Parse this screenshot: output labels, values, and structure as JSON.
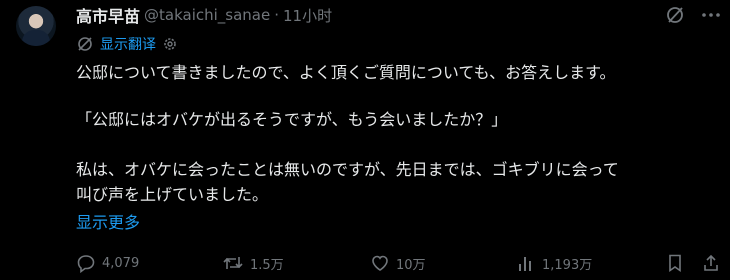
{
  "author": {
    "name": "高市早苗",
    "handle": "@takaichi_sanae",
    "separator": "·",
    "time": "11小时"
  },
  "translate": {
    "label": "显示翻译"
  },
  "post": {
    "lines": [
      "公邸について書きましたので、よく頂くご質問についても、お答えします。",
      "「公邸にはオバケが出るそうですが、もう会いましたか？」",
      "私は、オバケに会ったことは無いのですが、先日までは、ゴキブリに会って",
      "叫び声を上げていました。"
    ],
    "show_more": "显示更多"
  },
  "actions": {
    "replies": "4,079",
    "reposts": "1.5万",
    "likes": "10万",
    "views": "1,193万"
  },
  "colors": {
    "accent": "#1d9bf0",
    "muted": "#71767b",
    "text": "#e7e9ea",
    "background": "#000000"
  },
  "icons": [
    "grok-icon",
    "more-icon",
    "translate-icon",
    "gear-icon",
    "reply-icon",
    "repost-icon",
    "like-icon",
    "views-icon",
    "bookmark-icon",
    "share-icon"
  ]
}
